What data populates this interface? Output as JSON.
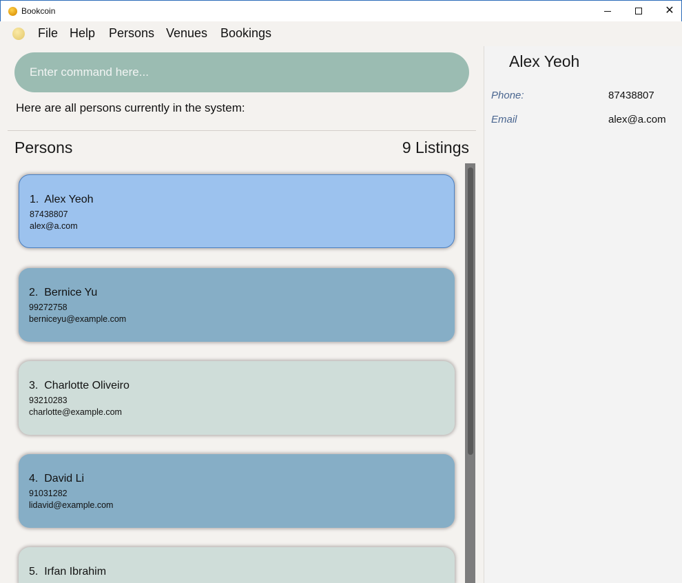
{
  "window": {
    "title": "Bookcoin",
    "controls": {
      "minimize": "minimize-icon",
      "maximize": "maximize-icon",
      "close": "✕"
    }
  },
  "menu": {
    "logo_icon": "coin-icon",
    "items": [
      "File",
      "Help",
      "Persons",
      "Venues",
      "Bookings"
    ]
  },
  "command": {
    "placeholder": "Enter command here..."
  },
  "result": {
    "message": "Here are all persons currently in the system:"
  },
  "list": {
    "title": "Persons",
    "count": "9 Listings",
    "persons": [
      {
        "index": "1.",
        "name": "Alex Yeoh",
        "phone": "87438807",
        "email": "alex@a.com",
        "selected": true,
        "color": "#9cc2ee"
      },
      {
        "index": "2.",
        "name": "Bernice Yu",
        "phone": "99272758",
        "email": "berniceyu@example.com",
        "selected": false,
        "color": "#86aec6"
      },
      {
        "index": "3.",
        "name": "Charlotte Oliveiro",
        "phone": "93210283",
        "email": "charlotte@example.com",
        "selected": false,
        "color": "#cfddd9"
      },
      {
        "index": "4.",
        "name": "David Li",
        "phone": "91031282",
        "email": "lidavid@example.com",
        "selected": false,
        "color": "#86aec6"
      },
      {
        "index": "5.",
        "name": "Irfan Ibrahim",
        "phone": "",
        "email": "",
        "selected": false,
        "color": "#cfddd9"
      }
    ]
  },
  "detail": {
    "name": "Alex Yeoh",
    "phone_label": "Phone:",
    "phone_value": "87438807",
    "email_label": "Email",
    "email_value": "alex@a.com"
  }
}
